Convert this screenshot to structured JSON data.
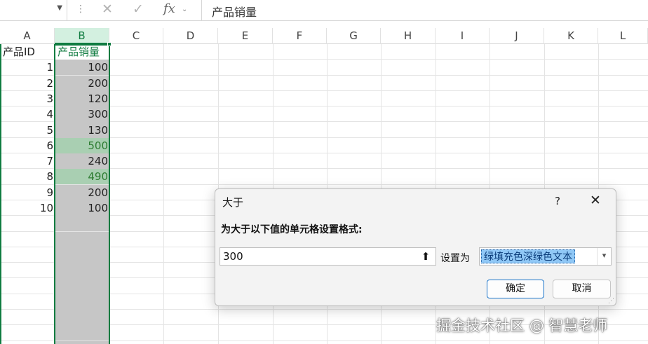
{
  "formula_bar": {
    "name_box": "",
    "fx_label": "fx",
    "content": "产品销量"
  },
  "columns": [
    "A",
    "B",
    "C",
    "D",
    "E",
    "F",
    "G",
    "H",
    "I",
    "J",
    "K",
    "L"
  ],
  "header_row": {
    "a": "产品ID",
    "b": "产品销量"
  },
  "data_rows": [
    {
      "id": "1",
      "sales": "100",
      "highlight": false
    },
    {
      "id": "2",
      "sales": "200",
      "highlight": false
    },
    {
      "id": "3",
      "sales": "120",
      "highlight": false
    },
    {
      "id": "4",
      "sales": "300",
      "highlight": false
    },
    {
      "id": "5",
      "sales": "130",
      "highlight": false
    },
    {
      "id": "6",
      "sales": "500",
      "highlight": true
    },
    {
      "id": "7",
      "sales": "240",
      "highlight": false
    },
    {
      "id": "8",
      "sales": "490",
      "highlight": true
    },
    {
      "id": "9",
      "sales": "200",
      "highlight": false
    },
    {
      "id": "10",
      "sales": "100",
      "highlight": false
    }
  ],
  "dialog": {
    "title": "大于",
    "help": "?",
    "close": "✕",
    "prompt": "为大于以下值的单元格设置格式:",
    "value": "300",
    "set_as_label": "设置为",
    "format_option": "绿填充色深绿色文本",
    "ok_label": "确定",
    "cancel_label": "取消"
  },
  "watermark": "掘金技术社区 @ 智慧老师",
  "colors": {
    "accent": "#107c41",
    "highlight_fill": "#a9cfb2",
    "highlight_text": "#2e7d32",
    "selection_fill": "#c6c6c6"
  }
}
